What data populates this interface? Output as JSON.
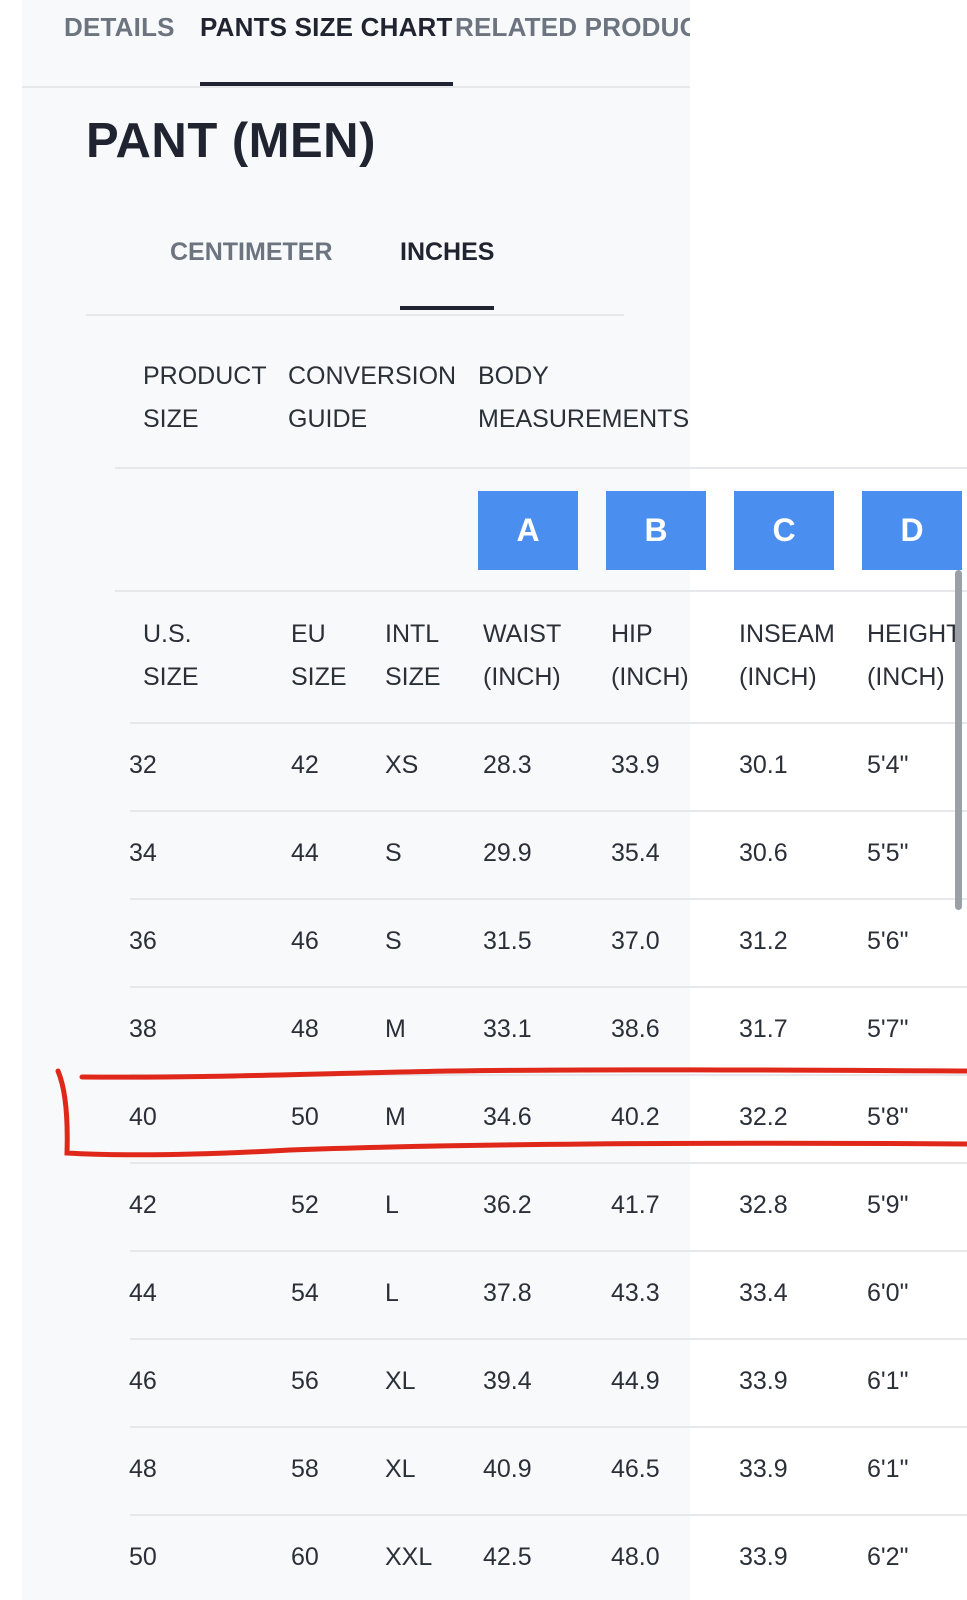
{
  "top_tabs": [
    {
      "label": "DETAILS"
    },
    {
      "label": "PANTS SIZE CHART"
    },
    {
      "label": "RELATED PRODUCTS"
    }
  ],
  "page_title": "PANT (MEN)",
  "unit_tabs": [
    {
      "label": "CENTIMETER"
    },
    {
      "label": "INCHES"
    }
  ],
  "group_headers": {
    "product_size": [
      "PRODUCT",
      "SIZE"
    ],
    "conversion_guide": [
      "CONVERSION",
      "GUIDE"
    ],
    "body_measurements": [
      "BODY",
      "MEASUREMENTS"
    ]
  },
  "measure_badges": [
    "A",
    "B",
    "C",
    "D"
  ],
  "column_headers": [
    [
      "U.S.",
      "SIZE"
    ],
    [
      "EU",
      "SIZE"
    ],
    [
      "INTL",
      "SIZE"
    ],
    [
      "WAIST",
      "(INCH)"
    ],
    [
      "HIP",
      "(INCH)"
    ],
    [
      "INSEAM",
      "(INCH)"
    ],
    [
      "HEIGHT",
      "(INCH)"
    ]
  ],
  "rows": [
    [
      "32",
      "42",
      "XS",
      "28.3",
      "33.9",
      "30.1",
      "5'4\""
    ],
    [
      "34",
      "44",
      "S",
      "29.9",
      "35.4",
      "30.6",
      "5'5\""
    ],
    [
      "36",
      "46",
      "S",
      "31.5",
      "37.0",
      "31.2",
      "5'6\""
    ],
    [
      "38",
      "48",
      "M",
      "33.1",
      "38.6",
      "31.7",
      "5'7\""
    ],
    [
      "40",
      "50",
      "M",
      "34.6",
      "40.2",
      "32.2",
      "5'8\""
    ],
    [
      "42",
      "52",
      "L",
      "36.2",
      "41.7",
      "32.8",
      "5'9\""
    ],
    [
      "44",
      "54",
      "L",
      "37.8",
      "43.3",
      "33.4",
      "6'0\""
    ],
    [
      "46",
      "56",
      "XL",
      "39.4",
      "44.9",
      "33.9",
      "6'1\""
    ],
    [
      "48",
      "58",
      "XL",
      "40.9",
      "46.5",
      "33.9",
      "6'1\""
    ],
    [
      "50",
      "60",
      "XXL",
      "42.5",
      "48.0",
      "33.9",
      "6'2\""
    ]
  ],
  "colors": {
    "badge_blue": "#4a8ef0",
    "annotation_red": "#e0281a",
    "active_tab": "#1f2430",
    "inactive_tab": "#6c7480"
  }
}
